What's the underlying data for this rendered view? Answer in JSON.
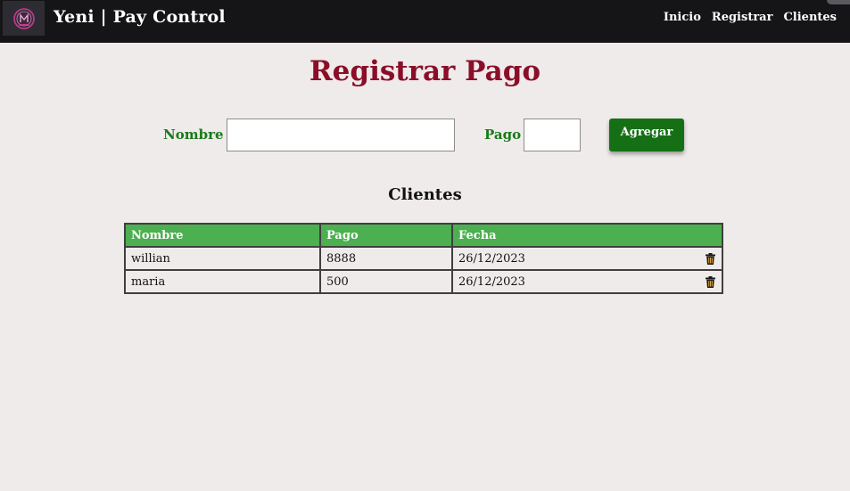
{
  "navbar": {
    "logo_icon": "mirror-logo-icon",
    "brand": "Yeni | Pay Control",
    "links": [
      {
        "label": "Inicio"
      },
      {
        "label": "Registrar"
      },
      {
        "label": "Clientes"
      }
    ]
  },
  "form": {
    "title": "Registrar Pago",
    "nombre_label": "Nombre",
    "nombre_value": "",
    "pago_label": "Pago",
    "pago_value": "",
    "submit_label": "Agregar"
  },
  "clients": {
    "title": "Clientes",
    "columns": [
      "Nombre",
      "Pago",
      "Fecha"
    ],
    "rows": [
      {
        "nombre": "willian",
        "pago": "8888",
        "fecha": "26/12/2023",
        "delete_icon": "trash-icon"
      },
      {
        "nombre": "maria",
        "pago": "500",
        "fecha": "26/12/2023",
        "delete_icon": "trash-icon"
      }
    ]
  },
  "colors": {
    "navbar_bg": "#151518",
    "page_bg": "#efebea",
    "title": "#8b0e28",
    "label": "#197a19",
    "button": "#157015",
    "table_header": "#4caf50"
  }
}
